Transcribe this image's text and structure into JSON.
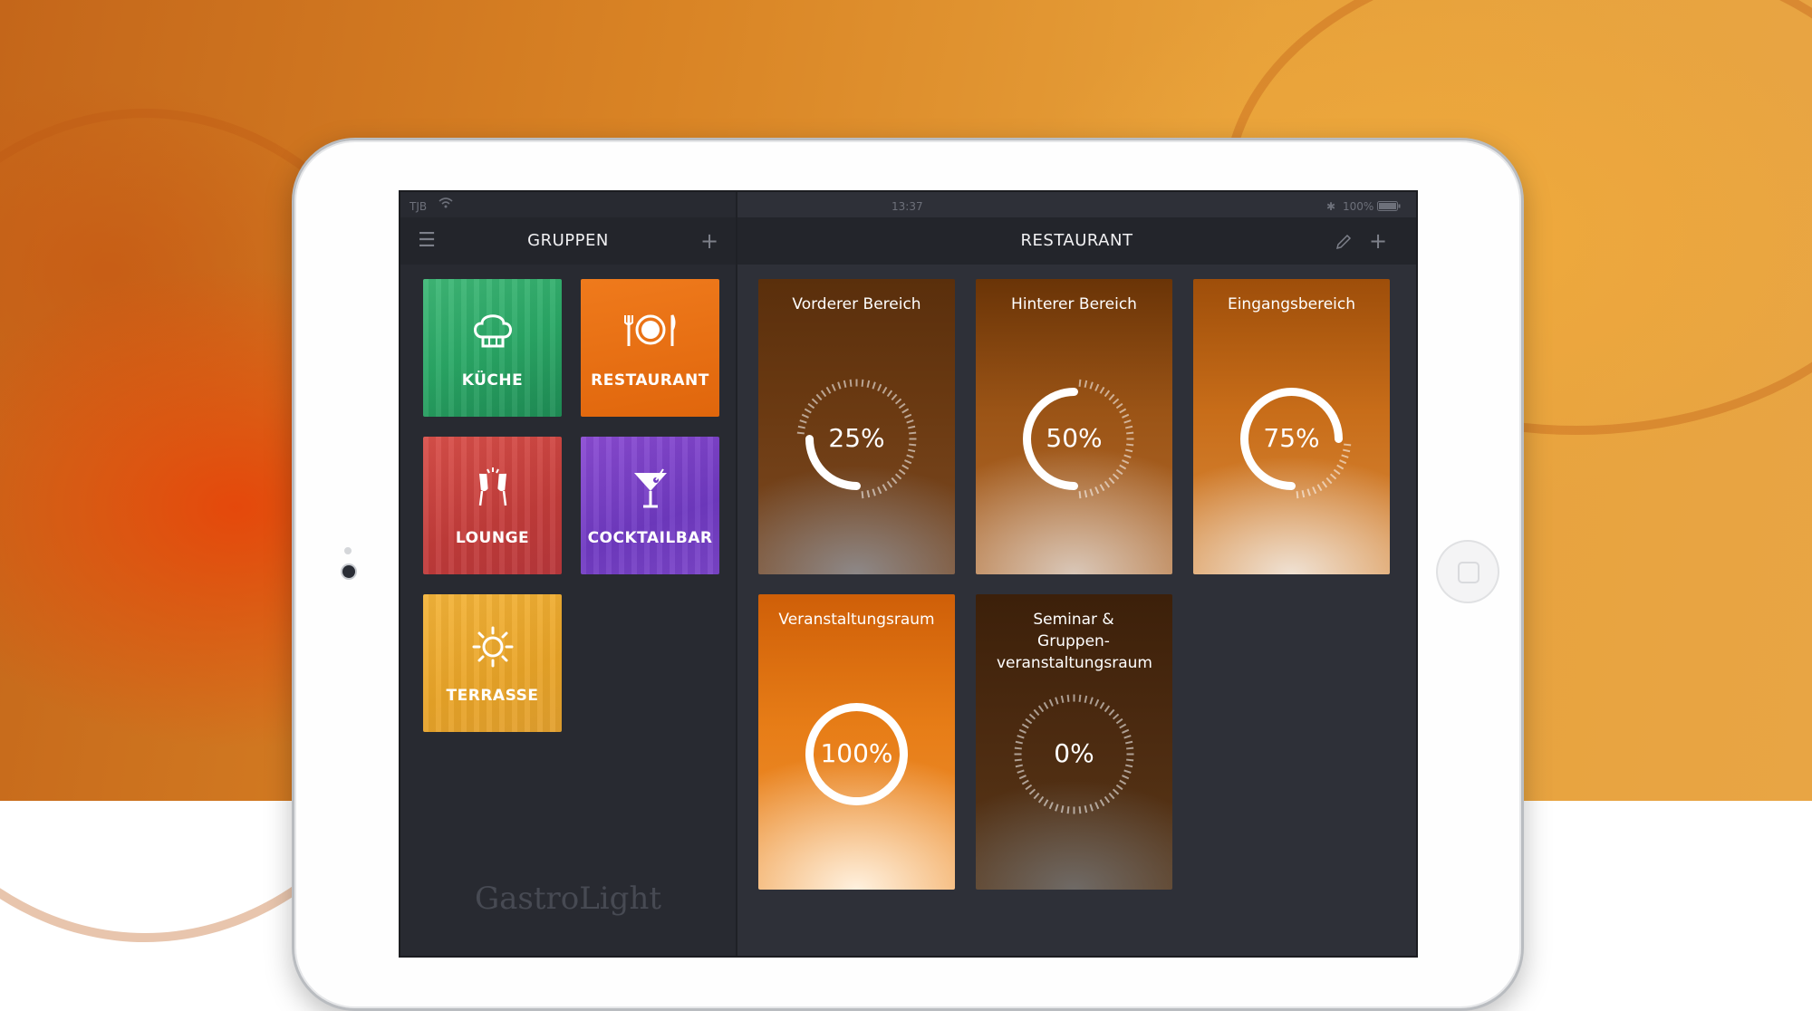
{
  "status_bar": {
    "carrier": "TJB",
    "time": "13:37",
    "battery": "100%"
  },
  "groups_panel": {
    "title": "GRUPPEN",
    "menu_icon": "hamburger-icon",
    "add_icon": "plus-icon",
    "tiles": [
      {
        "label": "KÜCHE",
        "icon": "chef-hat-icon",
        "color": "#2aa866"
      },
      {
        "label": "RESTAURANT",
        "icon": "plate-cutlery-icon",
        "color": "#e0660c"
      },
      {
        "label": "LOUNGE",
        "icon": "champagne-glasses-icon",
        "color": "#c33c3a"
      },
      {
        "label": "COCKTAILBAR",
        "icon": "cocktail-glass-icon",
        "color": "#6f39c1"
      },
      {
        "label": "TERRASSE",
        "icon": "sun-icon",
        "color": "#e9a428"
      }
    ],
    "logo": "GastroLight"
  },
  "restaurant_panel": {
    "title": "RESTAURANT",
    "edit_icon": "pencil-icon",
    "add_icon": "plus-icon",
    "areas": [
      {
        "name": "Vorderer Bereich",
        "level_label": "25%",
        "level": 0.25
      },
      {
        "name": "Hinterer Bereich",
        "level_label": "50%",
        "level": 0.5
      },
      {
        "name": "Eingangsbereich",
        "level_label": "75%",
        "level": 0.75
      },
      {
        "name": "Veranstaltungsraum",
        "level_label": "100%",
        "level": 1.0
      },
      {
        "name": "Seminar & Gruppen-veranstaltungsraum",
        "level_label": "0%",
        "level": 0.0
      }
    ]
  }
}
